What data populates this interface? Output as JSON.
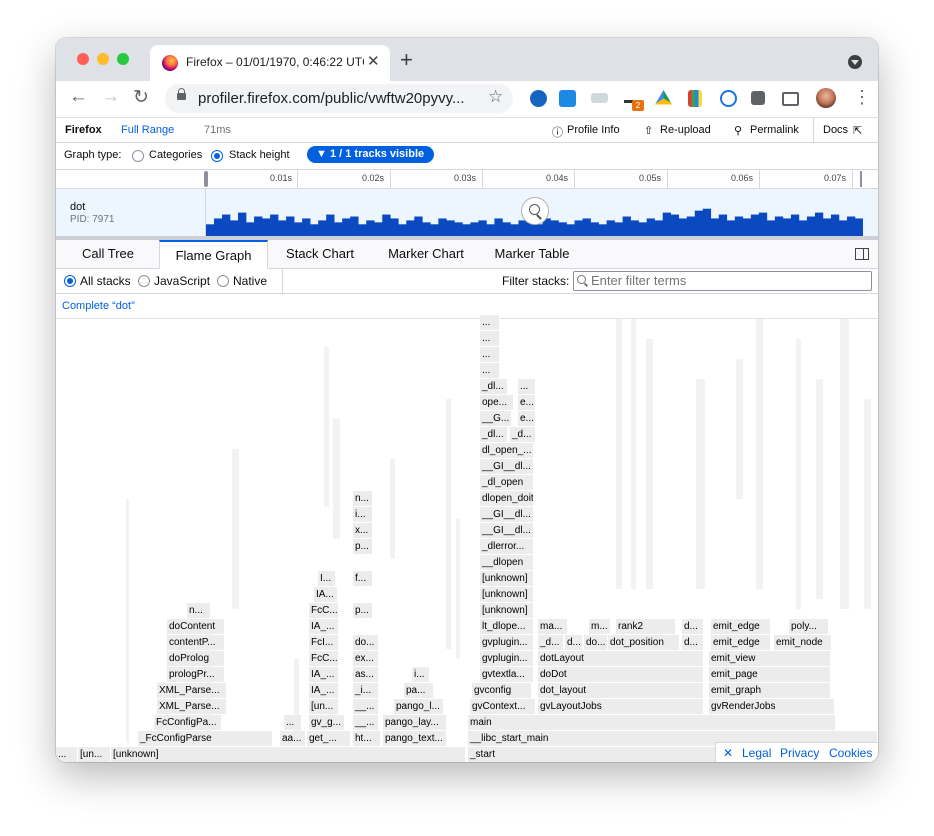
{
  "window": {
    "tab_title": "Firefox – 01/01/1970, 0:46:22 UTC",
    "tab_close": "✕",
    "new_tab": "+"
  },
  "toolbar": {
    "back": "←",
    "forward": "→",
    "reload": "↻",
    "url": "profiler.firefox.com/public/vwftw20pyvy...",
    "star": "☆",
    "ext_badge": "2",
    "kebab": "⋮"
  },
  "profiler_header": {
    "product": "Firefox",
    "range": "Full Range",
    "duration": "71ms",
    "profile_info": "Profile Info",
    "reupload": "Re-upload",
    "permalink": "Permalink",
    "docs": "Docs"
  },
  "graph_type": {
    "label": "Graph type:",
    "options": [
      "Categories",
      "Stack height"
    ],
    "selected": "Stack height",
    "tracks_visible": "▼ 1 / 1 tracks visible"
  },
  "timeline": {
    "ticks": [
      "0.01s",
      "0.02s",
      "0.03s",
      "0.04s",
      "0.05s",
      "0.06s",
      "0.07s"
    ]
  },
  "track": {
    "name": "dot",
    "pid": "PID: 7971",
    "activity_levels": [
      0.3,
      0.45,
      0.55,
      0.4,
      0.6,
      0.35,
      0.5,
      0.45,
      0.55,
      0.4,
      0.5,
      0.35,
      0.45,
      0.3,
      0.4,
      0.55,
      0.35,
      0.45,
      0.5,
      0.3,
      0.4,
      0.35,
      0.55,
      0.45,
      0.3,
      0.4,
      0.5,
      0.35,
      0.3,
      0.45,
      0.4,
      0.35,
      0.3,
      0.35,
      0.4,
      0.3,
      0.45,
      0.35,
      0.3,
      0.4,
      0.35,
      0.3,
      0.45,
      0.4,
      0.35,
      0.3,
      0.4,
      0.45,
      0.35,
      0.3,
      0.4,
      0.35,
      0.5,
      0.4,
      0.35,
      0.45,
      0.4,
      0.6,
      0.55,
      0.45,
      0.5,
      0.65,
      0.7,
      0.45,
      0.55,
      0.4,
      0.5,
      0.45,
      0.55,
      0.6,
      0.4,
      0.5,
      0.45,
      0.55,
      0.4,
      0.5,
      0.6,
      0.45,
      0.55,
      0.4,
      0.5,
      0.45
    ]
  },
  "panel_tabs": [
    "Call Tree",
    "Flame Graph",
    "Stack Chart",
    "Marker Chart",
    "Marker Table"
  ],
  "selected_tab": "Flame Graph",
  "stack_filter": {
    "options": [
      "All stacks",
      "JavaScript",
      "Native"
    ],
    "selected": "All stacks",
    "filter_label": "Filter stacks:",
    "filter_placeholder": "Enter filter terms"
  },
  "breadcrumb": "Complete “dot”",
  "flame_labels": {
    "start": "_start",
    "libc": "__libc_start_main",
    "main": "main",
    "gvcontext": "gvContext...",
    "gvlayoutjobs": "gvLayoutJobs",
    "gvrenderjobs": "gvRenderJobs",
    "gvconfig": "gvconfig",
    "dot_layout": "dot_layout",
    "emit_graph": "emit_graph",
    "gvtextla": "gvtextla...",
    "dodot": "doDot",
    "emit_page": "emit_page",
    "gvplugin1": "gvplugin...",
    "dotlayout": "dotLayout",
    "emit_view": "emit_view",
    "gvplugin2": "gvplugin...",
    "d1": "_d...",
    "d2": "d...",
    "do": "do...",
    "dot_position": "dot_position",
    "d3": "d...",
    "emit_edge1": "emit_edge",
    "emit_node": "emit_node",
    "lt_dlope": "lt_dlope...",
    "ma": "ma...",
    "m": "m...",
    "rank2": "rank2",
    "d4": "d...",
    "emit_edge2": "emit_edge",
    "poly": "poly...",
    "unknown1": "[unknown]",
    "unknown2": "[unknown]",
    "unknown3": "[unknown]",
    "dlopen": "__dlopen",
    "dlerror": "_dlerror...",
    "gi_dl1": "__GI__dl...",
    "gi_dl2": "__GI__dl...",
    "dlopen_doit": "dlopen_doit",
    "dl_open": "_dl_open",
    "gi_dl3": "__GI__dl...",
    "dl_open2": "dl_open_...",
    "dl_a": "_dl...",
    "dl_b": "_d...",
    "gg": "__G...",
    "e1": "e...",
    "ope": "ope...",
    "e2": "e...",
    "dl_c": "_dl...",
    "dots1": "...",
    "dots2": "...",
    "dots3": "...",
    "dots4": "...",
    "dots5": "...",
    "unknown_bottom": "[unknown]",
    "un": "[un...",
    "dots_b": "...",
    "fcconfigparse": "_FcConfigParse",
    "fcconfigpa": "FcConfigPa...",
    "xmlparse1": "XML_Parse...",
    "xmlparse2": "XML_Parse...",
    "prologpr": "prologPr...",
    "doprolog": "doProlog",
    "contentp": "contentP...",
    "docontent": "doContent",
    "n1": "n...",
    "aa": "aa...",
    "get": "get_...",
    "gvg": "gv_g...",
    "un2": "[un...",
    "ia1": "IA_...",
    "ia2": "IA_...",
    "fcc1": "FcC...",
    "fcl": "FcI...",
    "ia3": "IA_...",
    "fcc2": "FcC...",
    "ia4": "IA...",
    "i1": "I...",
    "ht": "ht...",
    "ul": "__...",
    "ul2": "__...",
    "i2": "_i...",
    "as": "as...",
    "ex": "ex...",
    "do2": "do...",
    "p1": "p...",
    "f1": "f...",
    "p2": "p...",
    "x1": "x...",
    "i3": "i...",
    "n2": "n...",
    "pango_text": "pango_text...",
    "pango_lay": "pango_lay...",
    "pango_l": "pango_l...",
    "pa": "pa...",
    "i4": "i..."
  },
  "footer": {
    "close": "✕",
    "legal": "Legal",
    "privacy": "Privacy",
    "cookies": "Cookies"
  },
  "colors": {
    "accent": "#0060df",
    "graph_fill": "#0a49c0",
    "frame_fill": "#ececec"
  }
}
